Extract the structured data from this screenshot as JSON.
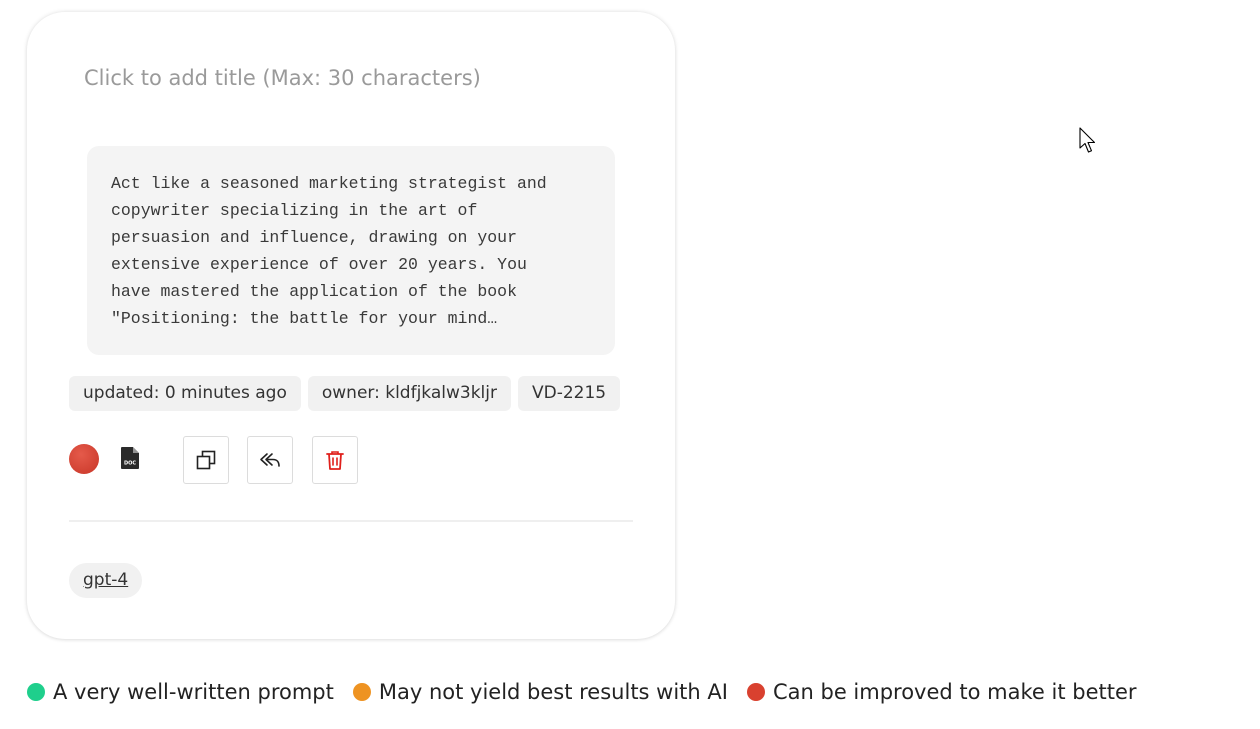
{
  "card": {
    "title_placeholder": "Click to add title (Max: 30 characters)",
    "prompt_text": "Act like a seasoned marketing strategist and\ncopywriter specializing in the art of\npersuasion and influence, drawing on your\nextensive experience of over 20 years. You\nhave mastered the application of the book\n\"Positioning: the battle for your mind…",
    "tags": {
      "updated": "updated: 0 minutes ago",
      "owner": "owner: kldfjkalw3kljr",
      "id": "VD-2215"
    },
    "status_color": "#d9412f",
    "icons": {
      "doc": "doc-file-icon",
      "copy": "copy-icon",
      "reply": "reply-icon",
      "delete": "trash-icon"
    },
    "delete_color": "#e0201c",
    "model": "gpt-4"
  },
  "legend": [
    {
      "label": "A very well-written prompt",
      "color": "#1fcf8c"
    },
    {
      "label": "May not yield best results with AI",
      "color": "#ee9322"
    },
    {
      "label": "Can be improved to make it better",
      "color": "#d9412f"
    }
  ]
}
